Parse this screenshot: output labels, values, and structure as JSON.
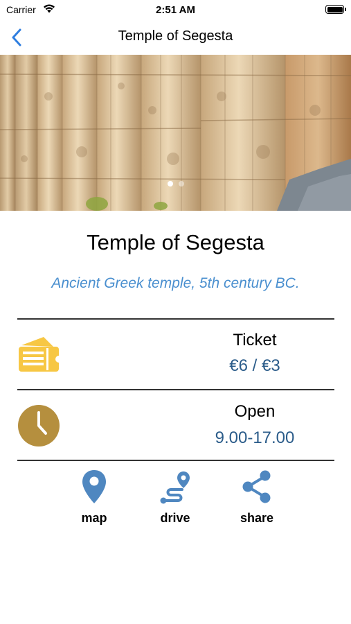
{
  "status_bar": {
    "carrier": "Carrier",
    "time": "2:51 AM"
  },
  "nav": {
    "title": "Temple of Segesta",
    "back_icon": "chevron-left-icon"
  },
  "hero": {
    "page_count": 2,
    "active_page": 1
  },
  "place": {
    "name": "Temple of Segesta",
    "description": "Ancient Greek temple, 5th century BC."
  },
  "ticket": {
    "label": "Ticket",
    "value": "€6 / €3",
    "icon": "ticket-icon"
  },
  "hours": {
    "label": "Open",
    "value": "9.00-17.00",
    "icon": "clock-icon"
  },
  "actions": {
    "map": "map",
    "drive": "drive",
    "share": "share"
  },
  "colors": {
    "accent": "#4a8fcf",
    "value_text": "#2b5c8a",
    "ticket_icon": "#f7c744",
    "clock_icon": "#b58f3e",
    "action_icon": "#4f87c0"
  }
}
